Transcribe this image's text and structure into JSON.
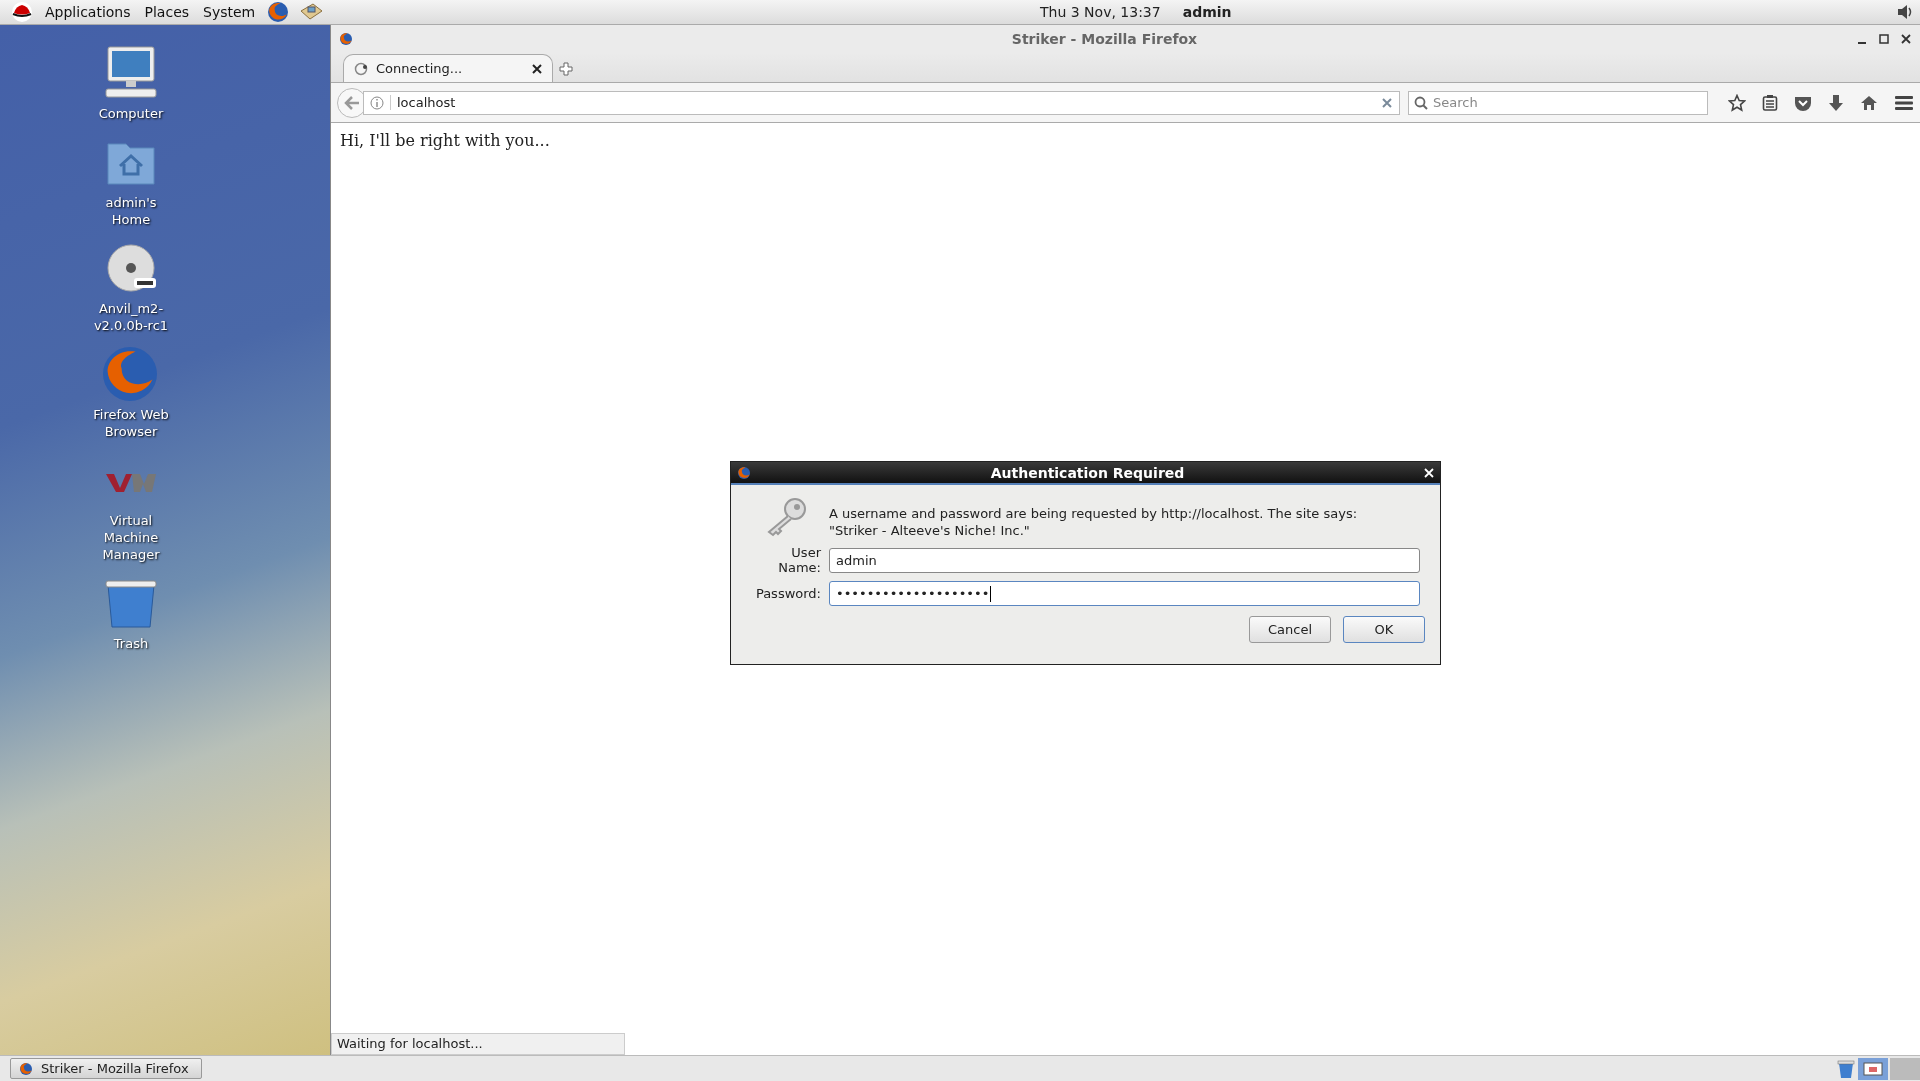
{
  "top_panel": {
    "menus": [
      "Applications",
      "Places",
      "System"
    ],
    "clock": "Thu  3 Nov, 13:37",
    "user": "admin"
  },
  "desktop_icons": [
    {
      "label": "Computer",
      "kind": "computer"
    },
    {
      "label": "admin's Home",
      "kind": "home"
    },
    {
      "label": "Anvil_m2-v2.0.0b-rc1",
      "kind": "dvd"
    },
    {
      "label": "Firefox Web Browser",
      "kind": "firefox"
    },
    {
      "label": "Virtual Machine Manager",
      "kind": "vmm"
    },
    {
      "label": "Trash",
      "kind": "trash"
    }
  ],
  "browser": {
    "title": "Striker - Mozilla Firefox",
    "tabs": [
      {
        "label": "Connecting...",
        "selected": true
      }
    ],
    "url": "localhost",
    "search": {
      "placeholder": "Search"
    },
    "page_text": "Hi, I'll be right with you...",
    "status": "Waiting for localhost..."
  },
  "dialog": {
    "title": "Authentication Required",
    "message": "A username and password are being requested by http://localhost. The site says: \"Striker - Alteeve's Niche! Inc.\"",
    "fields": [
      {
        "label": "User Name:",
        "value": "admin",
        "focused": false
      },
      {
        "label": "Password:",
        "value": "••••••••••••••••••••",
        "focused": true
      }
    ],
    "buttons": [
      {
        "label": "Cancel",
        "default": false
      },
      {
        "label": "OK",
        "default": true
      }
    ]
  },
  "taskbar": {
    "windows": [
      {
        "label": "Striker - Mozilla Firefox",
        "selected": false
      }
    ]
  }
}
